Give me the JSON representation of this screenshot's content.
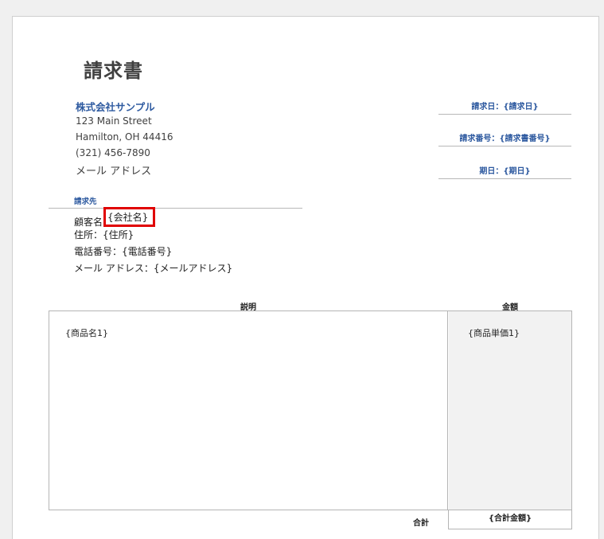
{
  "invoice": {
    "title": "請求書",
    "company": {
      "name": "株式会社サンプル",
      "street": "123 Main Street",
      "city": "Hamilton, OH 44416",
      "phone": "(321) 456-7890",
      "email": "メール アドレス"
    },
    "meta": {
      "date": "請求日：{請求日}",
      "number": "請求番号：{請求書番号}",
      "due": "期日：{期日}"
    },
    "bill_to": {
      "heading": "請求先",
      "customer_label": "顧客名",
      "customer_value": "{会社名}",
      "address": "住所：{住所}",
      "phone": "電話番号：{電話番号}",
      "email": "メール アドレス：{メールアドレス}"
    },
    "table": {
      "desc_header": "説明",
      "amount_header": "金額",
      "rows": [
        {
          "desc": "{商品名1}",
          "amount": "{商品単価1}"
        }
      ],
      "total_label": "合計",
      "total_value": "{合計金額}"
    }
  },
  "colors": {
    "accent": "#2e5aa0",
    "highlight_box": "#e00000"
  }
}
